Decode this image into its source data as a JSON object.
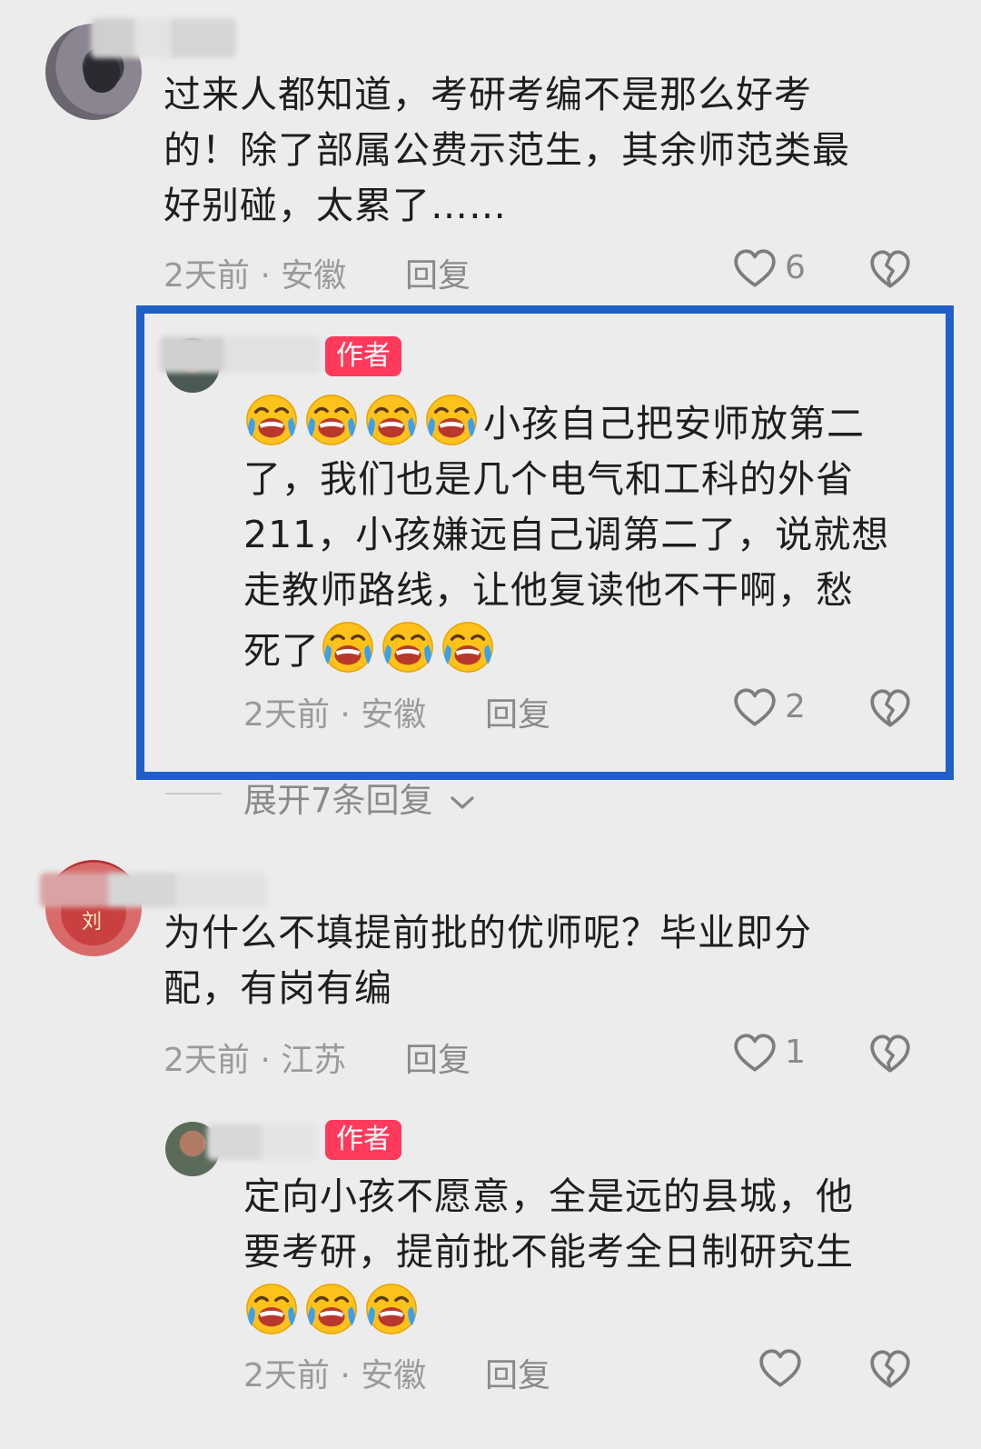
{
  "comments": [
    {
      "text": "过来人都知道，考研考编不是那么好考的！除了部属公费示范生，其余师范类最好别碰，太累了……",
      "lines": [
        "过来人都知道，考研考编不是那么好考",
        "的！除了部属公费示范生，其余师范类最",
        "好别碰，太累了……"
      ],
      "time": "2天前",
      "location": "安徽",
      "reply_label": "回复",
      "likes": "6",
      "reply": {
        "badge": "作者",
        "name_fragment": "湿无",
        "lines": [
          "小孩自己把安师放第二",
          "了，我们也是几个电气和工科的外省",
          "211，小孩嫌远自己调第二了，说就想",
          "走教师路线，让他复读他不干啊，愁",
          "死了"
        ],
        "time": "2天前",
        "location": "安徽",
        "reply_label": "回复",
        "likes": "2"
      },
      "expand_label": "展开7条回复"
    },
    {
      "lines": [
        "为什么不填提前批的优师呢？毕业即分",
        "配，有岗有编"
      ],
      "avatar_label": "刘",
      "time": "2天前",
      "location": "江苏",
      "reply_label": "回复",
      "likes": "1",
      "reply": {
        "badge": "作者",
        "lines": [
          "定向小孩不愿意，全是远的县城，他",
          "要考研，提前批不能考全日制研究生"
        ],
        "time": "2天前",
        "location": "安徽",
        "reply_label": "回复"
      }
    }
  ],
  "colors": {
    "background": "#ececec",
    "highlight": "#1f5fc7",
    "badge": "#ff3a5c"
  },
  "icons": {
    "like": "heart-icon",
    "dislike": "broken-heart-icon",
    "emoji": "crying-laughing-emoji",
    "expand": "chevron-down-icon"
  }
}
